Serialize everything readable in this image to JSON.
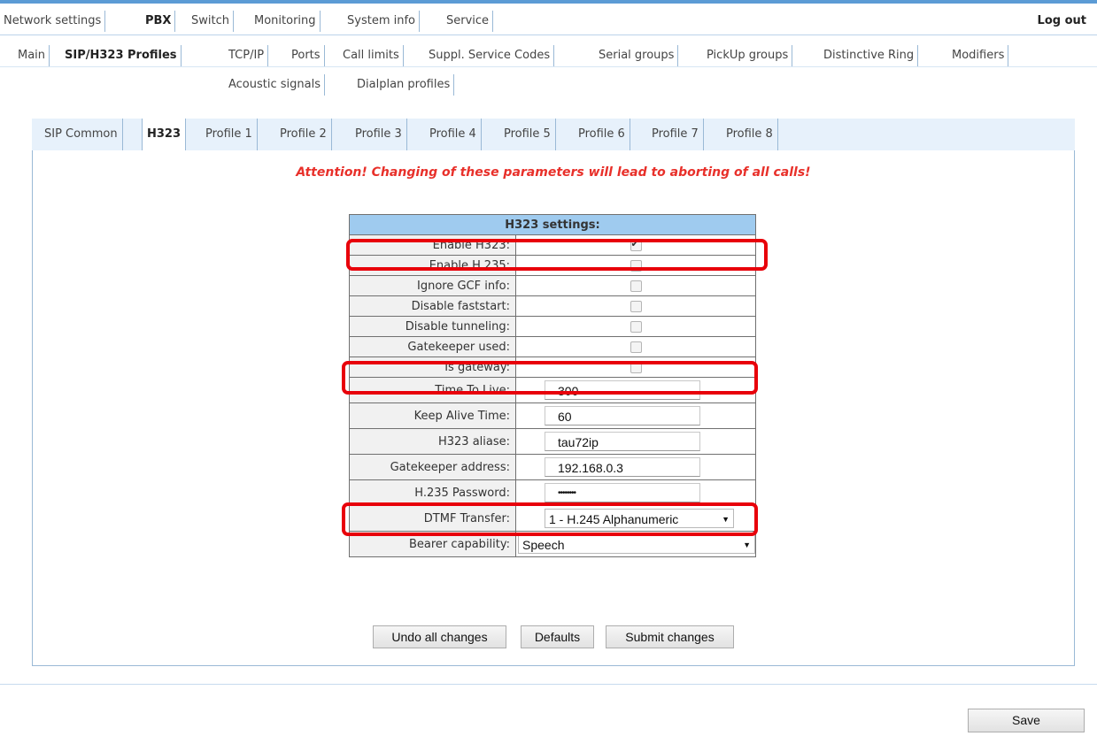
{
  "topnav": {
    "items": [
      "Network settings",
      "PBX",
      "Switch",
      "Monitoring",
      "System info",
      "Service"
    ],
    "logout": "Log out"
  },
  "subnav": {
    "items": [
      "Main",
      "SIP/H323 Profiles",
      "TCP/IP",
      "Ports",
      "Call limits",
      "Suppl. Service Codes",
      "Serial groups",
      "PickUp groups",
      "Distinctive Ring",
      "Modifiers",
      "Acoustic signals",
      "Dialplan profiles"
    ]
  },
  "profile_tabs": [
    "SIP Common",
    "H323",
    "Profile 1",
    "Profile 2",
    "Profile 3",
    "Profile 4",
    "Profile 5",
    "Profile 6",
    "Profile 7",
    "Profile 8"
  ],
  "attention": "Attention! Changing of these parameters will lead to aborting of all calls!",
  "h323": {
    "header": "H323 settings:",
    "checkboxes": [
      {
        "label": "Enable H323:",
        "checked": true
      },
      {
        "label": "Enable H.235:",
        "checked": false
      },
      {
        "label": "Ignore GCF info:",
        "checked": false
      },
      {
        "label": "Disable faststart:",
        "checked": false
      },
      {
        "label": "Disable tunneling:",
        "checked": false
      },
      {
        "label": "Gatekeeper used:",
        "checked": false
      },
      {
        "label": "Is gateway:",
        "checked": false
      }
    ],
    "fields": [
      {
        "label": "Time To Live:",
        "value": "300"
      },
      {
        "label": "Keep Alive Time:",
        "value": "60"
      },
      {
        "label": "H323 aliase:",
        "value": "tau72ip"
      },
      {
        "label": "Gatekeeper address:",
        "value": "192.168.0.3"
      },
      {
        "label": "H.235 Password:",
        "value": "••••••••"
      }
    ],
    "dtmf": {
      "label": "DTMF Transfer:",
      "value": "1 - H.245 Alphanumeric"
    },
    "bearer": {
      "label": "Bearer capability:",
      "value": "Speech"
    }
  },
  "buttons": {
    "undo": "Undo all changes",
    "defaults": "Defaults",
    "submit": "Submit changes",
    "save": "Save"
  },
  "colors": {
    "highlight": "#e8000a",
    "attention": "#e8302a",
    "table_header": "#9fcbef"
  }
}
